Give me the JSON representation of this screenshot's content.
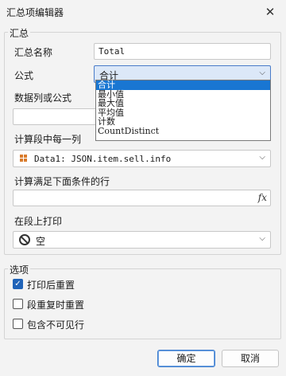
{
  "window": {
    "title": "汇总项编辑器",
    "close_glyph": "✕"
  },
  "summary_group": {
    "label": "汇总",
    "name_label": "汇总名称",
    "name_value": "Total",
    "formula_label": "公式",
    "formula_selected": "合计",
    "formula_options": [
      "合计",
      "最小值",
      "最大值",
      "平均值",
      "计数",
      "CountDistinct"
    ],
    "data_column_label": "数据列或公式",
    "data_column_value": "",
    "calc_each_label": "计算段中每一列",
    "calc_each_value": "Data1: JSON.item.sell.info",
    "condition_label": "计算满足下面条件的行",
    "condition_value": "",
    "fx_label": "fx",
    "print_on_label": "在段上打印",
    "print_on_value": "空"
  },
  "options_group": {
    "label": "选项",
    "items": [
      {
        "label": "打印后重置",
        "checked": true
      },
      {
        "label": "段重复时重置",
        "checked": false
      },
      {
        "label": "包含不可见行",
        "checked": false
      }
    ]
  },
  "buttons": {
    "ok": "确定",
    "cancel": "取消"
  },
  "colors": {
    "accent": "#1976d2",
    "check_fill": "#1f63b8",
    "field_icon": "#d97b2c"
  }
}
